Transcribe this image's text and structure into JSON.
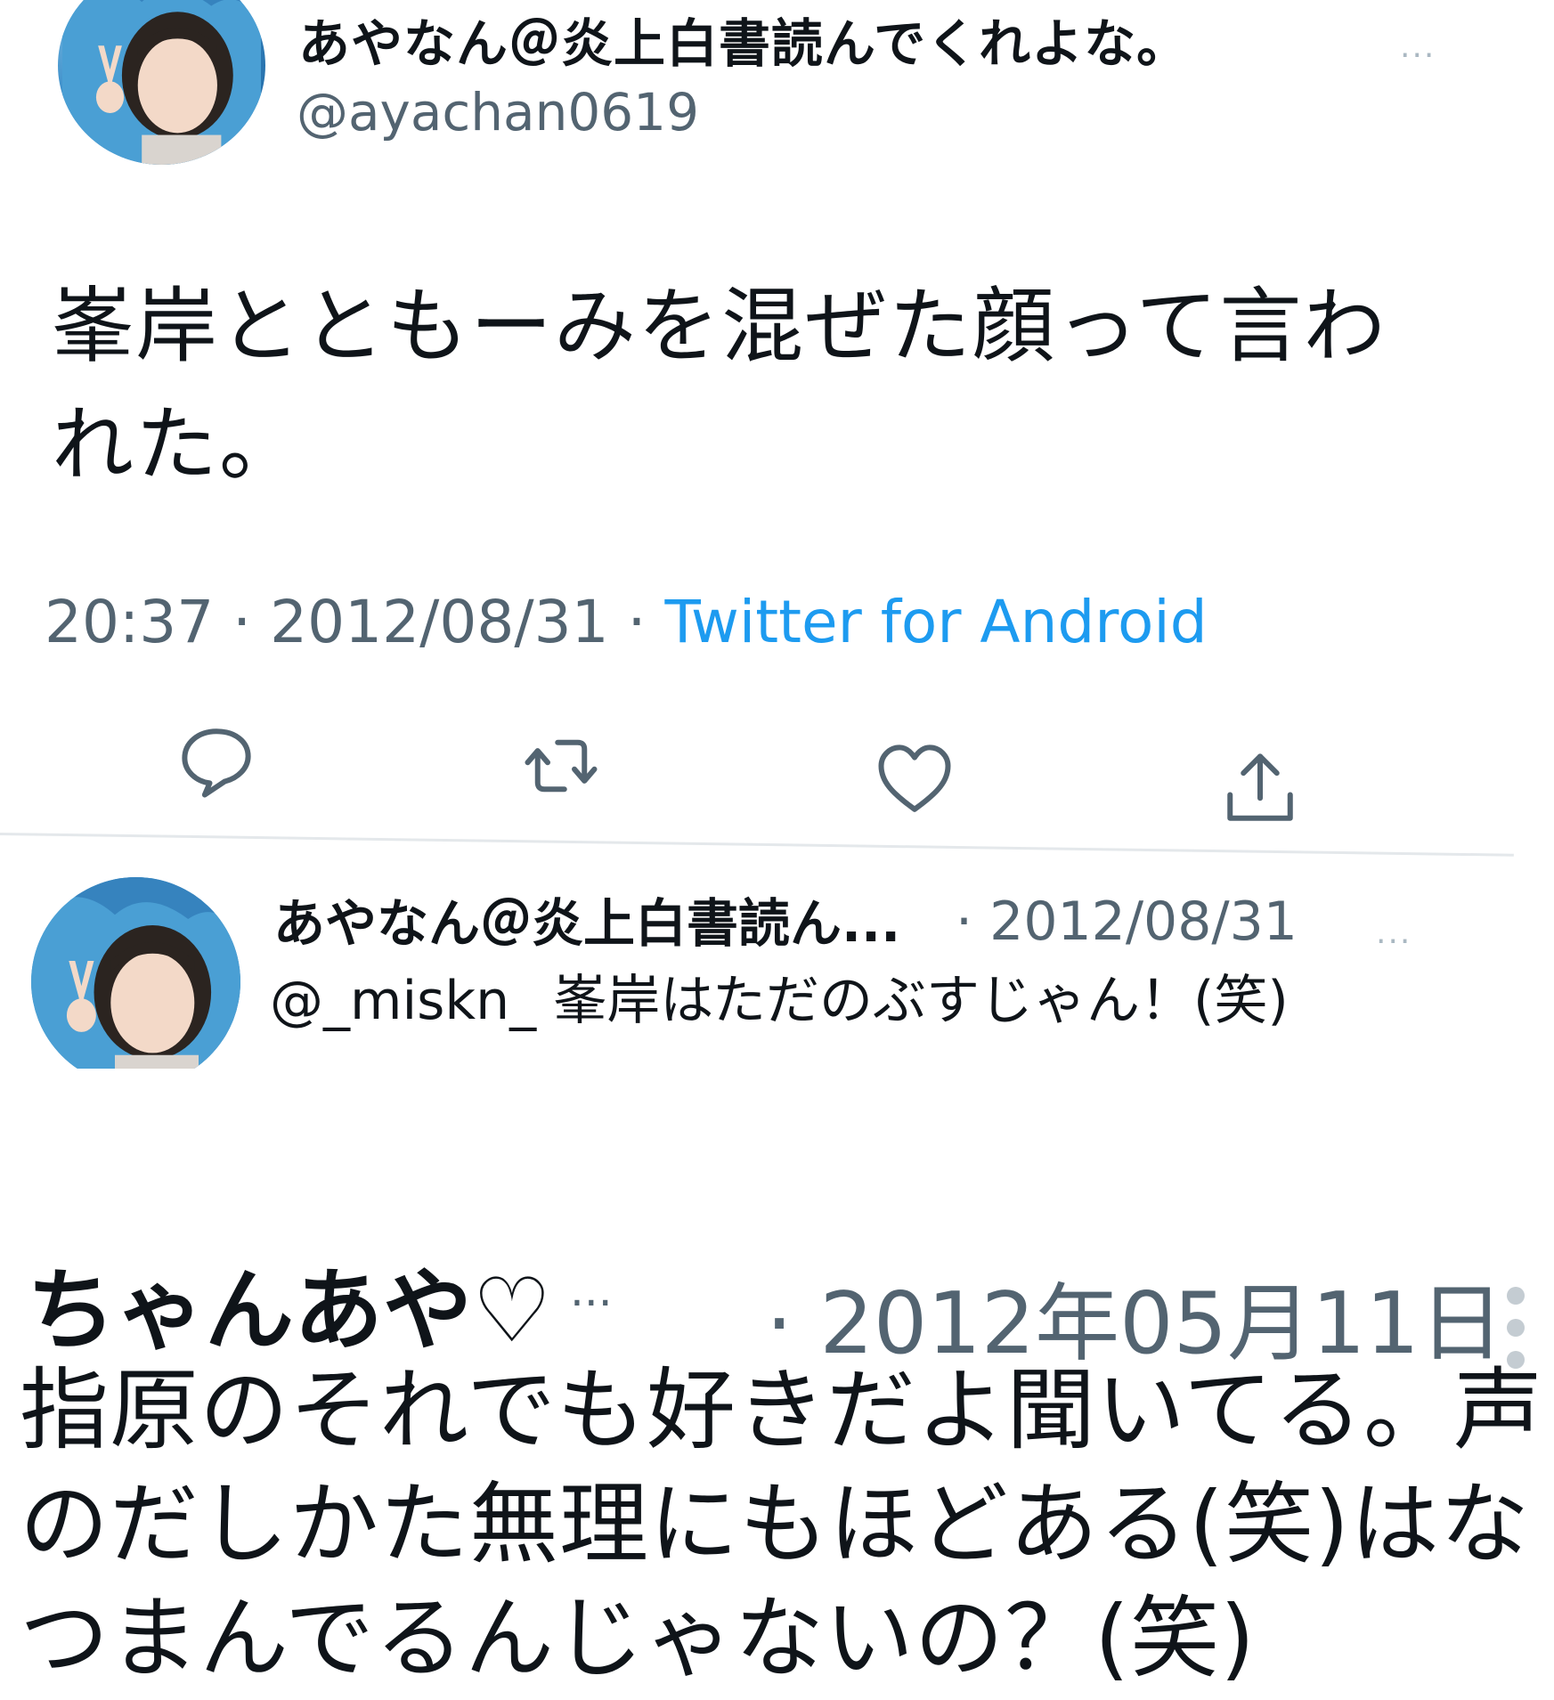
{
  "tweet1": {
    "display_name": "あやなん＠炎上白書読んでくれよな。",
    "handle": "@ayachan0619",
    "text": "峯岸とともーみを混ぜた顔って言われた。",
    "time": "20:37",
    "date": "2012/08/31",
    "source": "Twitter for Android",
    "more": "···"
  },
  "tweet2": {
    "display_name": "あやなん＠炎上白書読ん...",
    "date": "· 2012/08/31",
    "text": "@_miskn_ 峯岸はただのぶすじゃん！(笑)",
    "more": "···"
  },
  "tweet3": {
    "display_name": "ちゃんあや♡",
    "ellipsis": "...",
    "date": "· 2012年05月11日",
    "text": "指原のそれでも好きだよ聞いてる。声のだしかた無理にもほどある(笑)はなつまんでるんじゃないの？(笑)"
  },
  "colors": {
    "text": "#0f1419",
    "secondary": "#536471",
    "link": "#1d9bf0",
    "icon": "#536471",
    "divider": "#e4e8eb"
  },
  "icons": {
    "reply": "speech-bubble",
    "retweet": "two-arrows-loop",
    "like": "heart-outline",
    "share": "upload-arrow-tray"
  }
}
